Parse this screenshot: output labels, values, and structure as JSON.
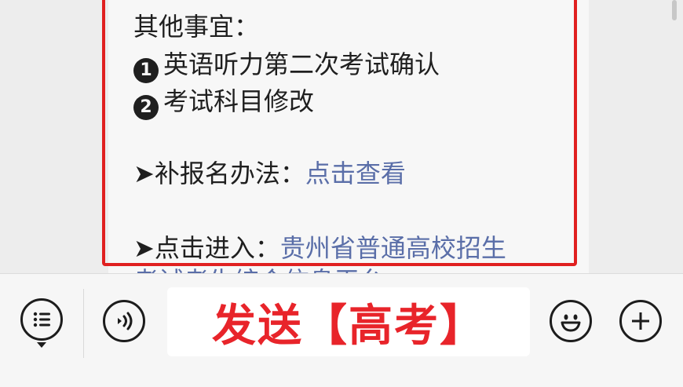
{
  "message": {
    "other_matters_title": "其他事宜：",
    "items": [
      {
        "number": "1",
        "text": "英语听力第二次考试确认"
      },
      {
        "number": "2",
        "text": "考试科目修改"
      }
    ],
    "supplement": {
      "prefix": "➤补报名办法：",
      "link": "点击查看"
    },
    "enter": {
      "prefix": "➤点击进入：",
      "link_line1": "贵州省普通高校招生",
      "link_line2": "考试考生综合信息平台"
    }
  },
  "input_bar": {
    "text": "发送【高考】"
  },
  "icons": {
    "menu": "menu-list-icon",
    "voice": "voice-icon",
    "emoji": "emoji-icon",
    "add": "plus-icon"
  },
  "colors": {
    "highlight_border": "#e02020",
    "link": "#5a6ea8",
    "input_text": "#e8242a"
  }
}
